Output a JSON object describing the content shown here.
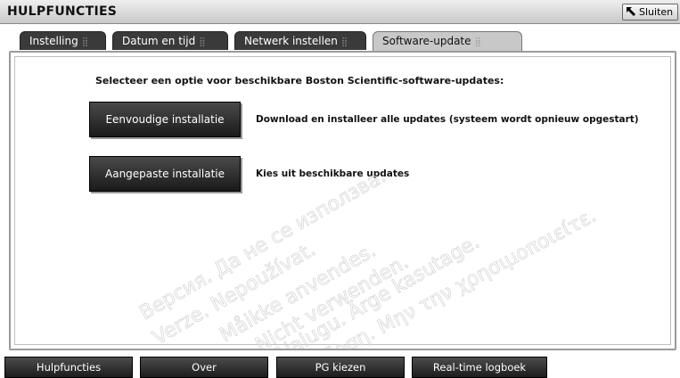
{
  "window": {
    "title": "HULPFUNCTIES",
    "close_label": "Sluiten"
  },
  "tabs": [
    {
      "label": "Instelling",
      "active": false
    },
    {
      "label": "Datum en tijd",
      "active": false
    },
    {
      "label": "Netwerk instellen",
      "active": false
    },
    {
      "label": "Software-update",
      "active": true
    }
  ],
  "main": {
    "heading": "Selecteer een optie voor beschikbare Boston Scientific-software-updates:",
    "options": [
      {
        "button": "Eenvoudige installatie",
        "description": "Download en installeer alle updates (systeem wordt opnieuw opgestart)"
      },
      {
        "button": "Aangepaste installatie",
        "description": "Kies uit beschikbare updates"
      }
    ]
  },
  "bottom_nav": [
    {
      "label": "Hulpfuncties"
    },
    {
      "label": "Over"
    },
    {
      "label": "PG kiezen"
    },
    {
      "label": "Real-time logboek"
    }
  ],
  "watermark": [
    "Версия. Да не се използва.",
    "Verze. Nepoužívat.",
    "Måikke anvendes.",
    "Nicht verwenden.",
    "Ajalugu. Ärge kasutage.",
    "Έκδοση. Μην την χρησιμοποιείτε."
  ],
  "colors": {
    "button_dark": "#2a2a2a",
    "tab_active": "#c8c8c8",
    "titlebar": "#d8d8d8"
  }
}
